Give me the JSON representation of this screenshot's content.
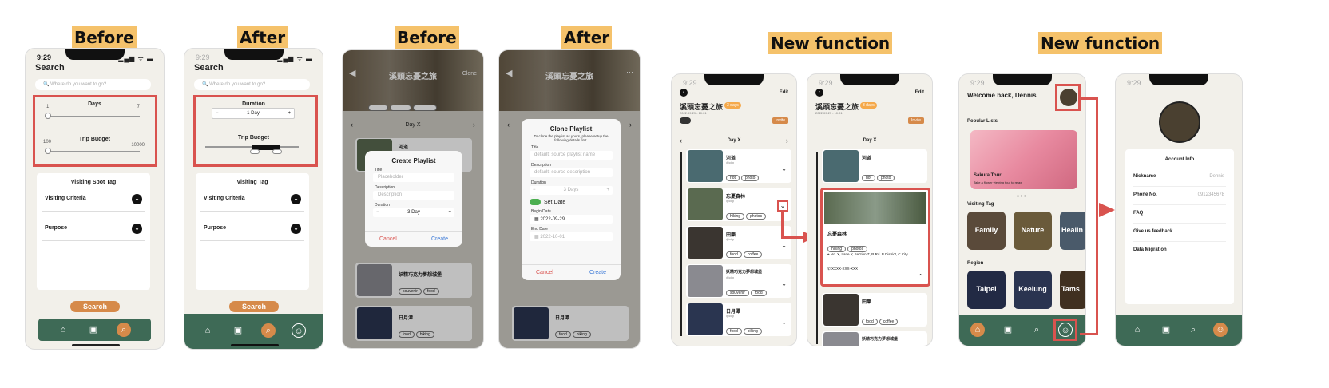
{
  "headers": {
    "before1": "Before",
    "after1": "After",
    "before2": "Before",
    "after2": "After",
    "newfn1": "New function",
    "newfn2": "New function"
  },
  "status": {
    "time": "9:29",
    "signal": "▂▄▆ ᯤ ▬"
  },
  "search_screen": {
    "title": "Search",
    "placeholder": "Where do you want to go?",
    "before": {
      "days_label": "Days",
      "days_min": "1",
      "days_max": "7",
      "budget_label": "Trip Budget",
      "budget_min": "100",
      "budget_max": "10000",
      "tag_title": "Visiting Spot Tag"
    },
    "after": {
      "duration_label": "Duration",
      "duration_value": "1 Day",
      "minus": "−",
      "plus": "+",
      "budget_label": "Trip Budget",
      "tag_title": "Visiting Tag"
    },
    "criteria": "Visiting Criteria",
    "purpose": "Purpose",
    "search_button": "Search",
    "chevron": "⌄"
  },
  "playlist": {
    "title": "溪頭忘憂之旅",
    "clone": "Clone",
    "dayx": "Day X",
    "tags": [
      "Family",
      "Healing",
      "Mountain"
    ],
    "items": [
      {
        "name": "河道",
        "tags": [
          "riot",
          "photo"
        ]
      },
      {
        "name": "忘憂森林",
        "tags": [
          "hiking",
          "photos"
        ]
      },
      {
        "name": "田樂",
        "tags": [
          "food",
          "coffee"
        ]
      },
      {
        "name": "妖精巧克力夢想城堡",
        "tags": [
          "souvenir",
          "food"
        ]
      },
      {
        "name": "日月潭",
        "tags": [
          "food",
          "biking"
        ]
      }
    ],
    "city": "@city"
  },
  "create_modal": {
    "title": "Create Playlist",
    "title_label": "Title",
    "title_ph": "Placeholder",
    "desc_label": "Description",
    "desc_ph": "Description",
    "dur_label": "Duration",
    "dur_value": "3 Day",
    "cancel": "Cancel",
    "create": "Create"
  },
  "clone_modal": {
    "title": "Clone Playlist",
    "subtitle": "To clone the playlist as yours, please setup the following details first.",
    "title_label": "Title",
    "title_ph": "default: source playlist name",
    "desc_label": "Description",
    "desc_ph": "default: source description",
    "dur_label": "Duration",
    "dur_value": "3 Days",
    "set_date": "Set Date",
    "begin_label": "Begin Date",
    "begin_value": "2022-09-29",
    "end_label": "End Date",
    "end_value": "2022-10-01",
    "cancel": "Cancel",
    "create": "Create"
  },
  "detail": {
    "title": "溪頭忘憂之旅",
    "badge": "3 days",
    "edit": "Edit",
    "invite": "Invite",
    "dates": "2022.09.29 - 10.01",
    "dayx": "Day X",
    "expanded_name": "忘憂森林",
    "address": "No. X, Lane Y, Section Z, R Rd. B District, C City",
    "phone": "XXXX-XXX-XXX"
  },
  "home": {
    "welcome": "Welcome back, Dennis",
    "popular": "Popular Lists",
    "card_title": "Sakura Tour",
    "card_sub": "Take a flower viewing tour to relax",
    "visiting_tag": "Visiting Tag",
    "tags": [
      "Family",
      "Nature",
      "Healin"
    ],
    "region": "Region",
    "regions": [
      "Taipei",
      "Keelung",
      "Tams"
    ]
  },
  "account": {
    "title": "Account Info",
    "rows": [
      {
        "label": "Nickname",
        "value": "Dennis"
      },
      {
        "label": "Phone No.",
        "value": "0912345678"
      },
      {
        "label": "FAQ",
        "value": ""
      },
      {
        "label": "Give us feedback",
        "value": ""
      },
      {
        "label": "Data Migration",
        "value": ""
      }
    ]
  },
  "colors": {
    "accent": "#d68a4a",
    "nav": "#3e6a56",
    "highlight": "#f5c26b",
    "red": "#d9534f"
  }
}
